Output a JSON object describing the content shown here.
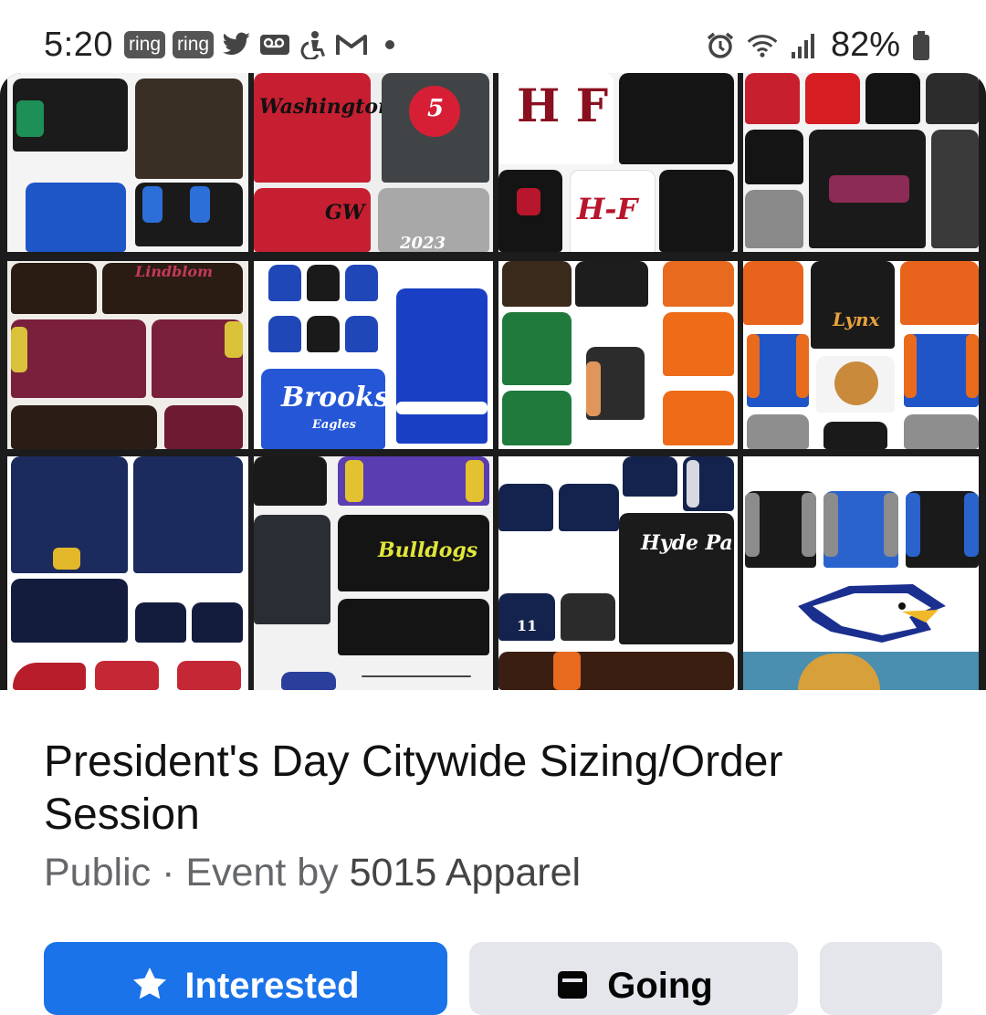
{
  "status_bar": {
    "time": "5:20",
    "notification_badges": [
      "ring",
      "ring"
    ],
    "notification_icons": [
      "twitter-icon",
      "voicemail-icon",
      "accessibility-icon",
      "gmail-icon",
      "dot-icon"
    ],
    "right_icons": [
      "alarm-icon",
      "wifi-icon",
      "signal-icon",
      "battery-icon"
    ],
    "battery_percent": "82%"
  },
  "cover": {
    "jacket_labels": [
      "Washington",
      "H F",
      "H-F",
      "GW",
      "2023",
      "Lindblom",
      "Brooks",
      "Eagles",
      "Lynx",
      "Hyde Park",
      "Bulldogs",
      "11",
      "5"
    ]
  },
  "event": {
    "title": "President's Day Citywide Sizing/Order Session",
    "privacy": "Public",
    "separator": " · ",
    "event_by_label": "Event by",
    "host": "5015 Apparel"
  },
  "actions": {
    "interested_label": "Interested",
    "going_label": "Going"
  },
  "colors": {
    "interested_bg": "#1a73e8",
    "secondary_bg": "#e4e6eb",
    "meta_text": "#65676b"
  }
}
